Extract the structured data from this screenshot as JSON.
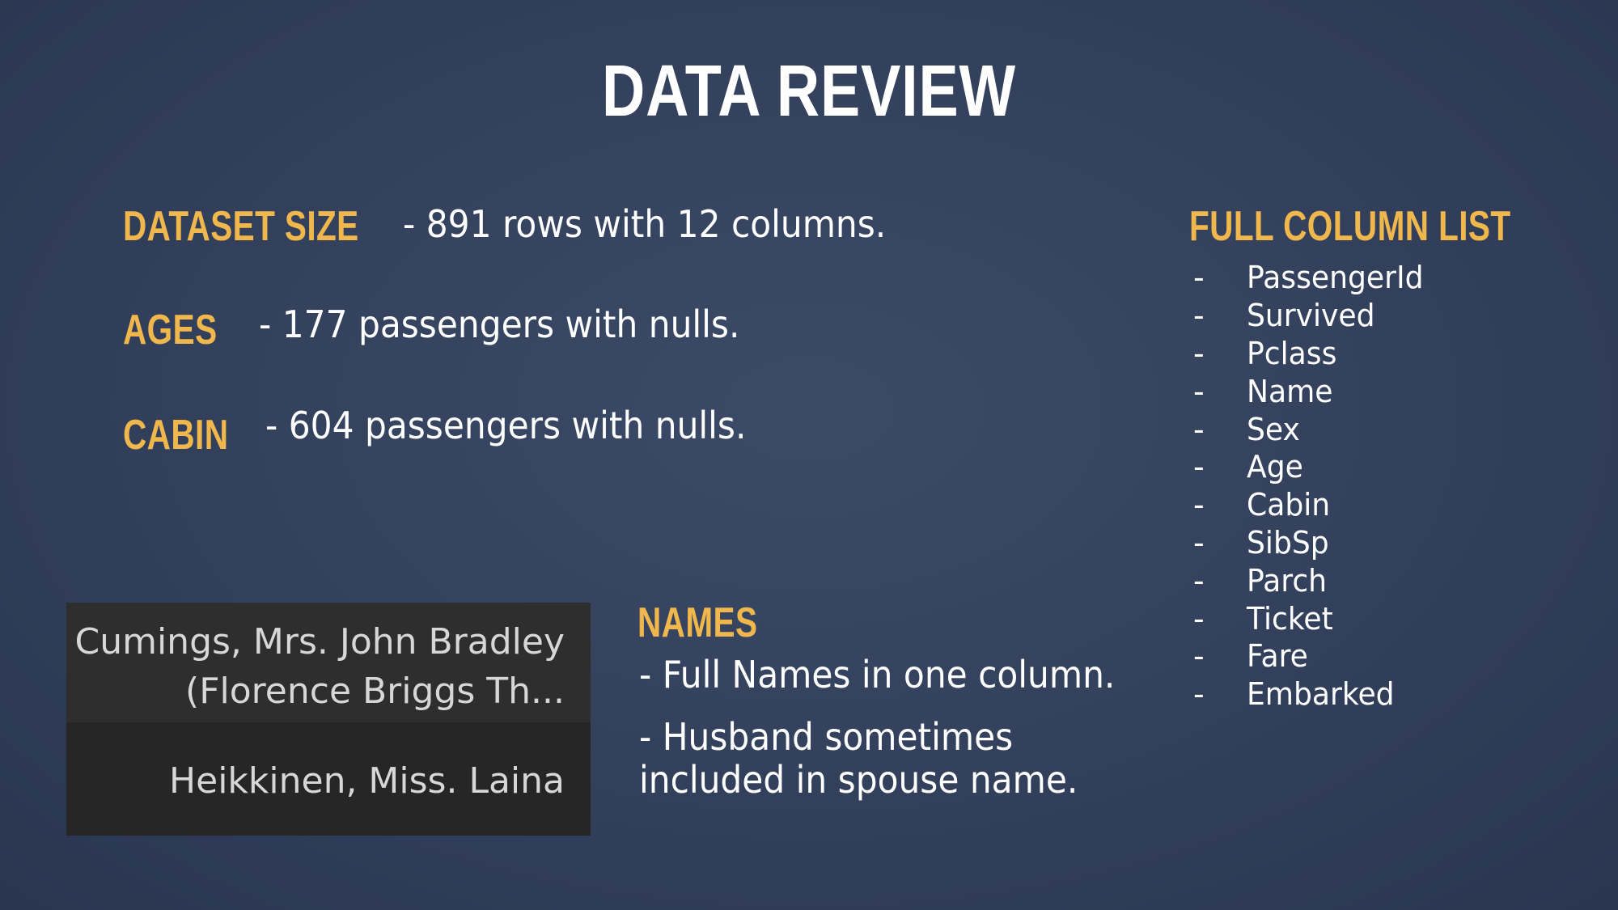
{
  "slide": {
    "title": "DATA REVIEW",
    "dataset_size": {
      "label": "DATASET SIZE",
      "text": "- 891 rows with 12 columns."
    },
    "ages": {
      "label": "AGES",
      "text": "- 177 passengers with nulls."
    },
    "cabin": {
      "label": "CABIN",
      "text": "- 604 passengers with nulls."
    },
    "names": {
      "label": "NAMES",
      "points": [
        "- Full Names in one column.",
        "- Husband sometimes",
        "included in spouse name."
      ]
    },
    "name_examples": [
      {
        "line1": "Cumings, Mrs. John Bradley",
        "line2": "(Florence Briggs Th..."
      },
      {
        "line1": "Heikkinen, Miss. Laina"
      }
    ],
    "column_list": {
      "label": "FULL COLUMN LIST",
      "dash": "-",
      "columns": [
        "PassengerId",
        "Survived",
        "Pclass",
        "Name",
        "Sex",
        "Age",
        "Cabin",
        "SibSp",
        "Parch",
        "Ticket",
        "Fare",
        "Embarked"
      ]
    },
    "colors": {
      "heading": "#f0b74c",
      "text": "#ffffff",
      "background": "#34425e"
    }
  }
}
